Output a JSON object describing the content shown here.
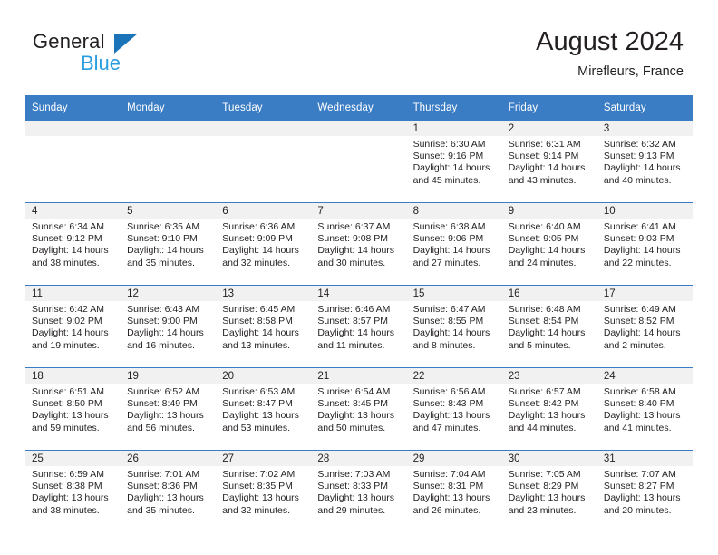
{
  "brand": {
    "name_part1": "General",
    "name_part2": "Blue",
    "logo_icon": "triangle-logo-icon"
  },
  "header": {
    "title": "August 2024",
    "location": "Mirefleurs, France"
  },
  "calendar": {
    "weekday_headers": [
      "Sunday",
      "Monday",
      "Tuesday",
      "Wednesday",
      "Thursday",
      "Friday",
      "Saturday"
    ],
    "colors": {
      "header_background": "#3b7dc4",
      "header_text": "#ffffff",
      "daynum_band": "#f1f1f1",
      "cell_background": "#ffffff",
      "text": "#231f20",
      "brand_blue": "#2a9ce0",
      "logo_blue": "#1b73b8"
    },
    "weeks": [
      [
        {
          "day": "",
          "empty": true,
          "sunrise": "",
          "sunset": "",
          "daylight_line1": "",
          "daylight_line2": ""
        },
        {
          "day": "",
          "empty": true,
          "sunrise": "",
          "sunset": "",
          "daylight_line1": "",
          "daylight_line2": ""
        },
        {
          "day": "",
          "empty": true,
          "sunrise": "",
          "sunset": "",
          "daylight_line1": "",
          "daylight_line2": ""
        },
        {
          "day": "",
          "empty": true,
          "sunrise": "",
          "sunset": "",
          "daylight_line1": "",
          "daylight_line2": ""
        },
        {
          "day": "1",
          "empty": false,
          "sunrise": "Sunrise: 6:30 AM",
          "sunset": "Sunset: 9:16 PM",
          "daylight_line1": "Daylight: 14 hours",
          "daylight_line2": "and 45 minutes."
        },
        {
          "day": "2",
          "empty": false,
          "sunrise": "Sunrise: 6:31 AM",
          "sunset": "Sunset: 9:14 PM",
          "daylight_line1": "Daylight: 14 hours",
          "daylight_line2": "and 43 minutes."
        },
        {
          "day": "3",
          "empty": false,
          "sunrise": "Sunrise: 6:32 AM",
          "sunset": "Sunset: 9:13 PM",
          "daylight_line1": "Daylight: 14 hours",
          "daylight_line2": "and 40 minutes."
        }
      ],
      [
        {
          "day": "4",
          "empty": false,
          "sunrise": "Sunrise: 6:34 AM",
          "sunset": "Sunset: 9:12 PM",
          "daylight_line1": "Daylight: 14 hours",
          "daylight_line2": "and 38 minutes."
        },
        {
          "day": "5",
          "empty": false,
          "sunrise": "Sunrise: 6:35 AM",
          "sunset": "Sunset: 9:10 PM",
          "daylight_line1": "Daylight: 14 hours",
          "daylight_line2": "and 35 minutes."
        },
        {
          "day": "6",
          "empty": false,
          "sunrise": "Sunrise: 6:36 AM",
          "sunset": "Sunset: 9:09 PM",
          "daylight_line1": "Daylight: 14 hours",
          "daylight_line2": "and 32 minutes."
        },
        {
          "day": "7",
          "empty": false,
          "sunrise": "Sunrise: 6:37 AM",
          "sunset": "Sunset: 9:08 PM",
          "daylight_line1": "Daylight: 14 hours",
          "daylight_line2": "and 30 minutes."
        },
        {
          "day": "8",
          "empty": false,
          "sunrise": "Sunrise: 6:38 AM",
          "sunset": "Sunset: 9:06 PM",
          "daylight_line1": "Daylight: 14 hours",
          "daylight_line2": "and 27 minutes."
        },
        {
          "day": "9",
          "empty": false,
          "sunrise": "Sunrise: 6:40 AM",
          "sunset": "Sunset: 9:05 PM",
          "daylight_line1": "Daylight: 14 hours",
          "daylight_line2": "and 24 minutes."
        },
        {
          "day": "10",
          "empty": false,
          "sunrise": "Sunrise: 6:41 AM",
          "sunset": "Sunset: 9:03 PM",
          "daylight_line1": "Daylight: 14 hours",
          "daylight_line2": "and 22 minutes."
        }
      ],
      [
        {
          "day": "11",
          "empty": false,
          "sunrise": "Sunrise: 6:42 AM",
          "sunset": "Sunset: 9:02 PM",
          "daylight_line1": "Daylight: 14 hours",
          "daylight_line2": "and 19 minutes."
        },
        {
          "day": "12",
          "empty": false,
          "sunrise": "Sunrise: 6:43 AM",
          "sunset": "Sunset: 9:00 PM",
          "daylight_line1": "Daylight: 14 hours",
          "daylight_line2": "and 16 minutes."
        },
        {
          "day": "13",
          "empty": false,
          "sunrise": "Sunrise: 6:45 AM",
          "sunset": "Sunset: 8:58 PM",
          "daylight_line1": "Daylight: 14 hours",
          "daylight_line2": "and 13 minutes."
        },
        {
          "day": "14",
          "empty": false,
          "sunrise": "Sunrise: 6:46 AM",
          "sunset": "Sunset: 8:57 PM",
          "daylight_line1": "Daylight: 14 hours",
          "daylight_line2": "and 11 minutes."
        },
        {
          "day": "15",
          "empty": false,
          "sunrise": "Sunrise: 6:47 AM",
          "sunset": "Sunset: 8:55 PM",
          "daylight_line1": "Daylight: 14 hours",
          "daylight_line2": "and 8 minutes."
        },
        {
          "day": "16",
          "empty": false,
          "sunrise": "Sunrise: 6:48 AM",
          "sunset": "Sunset: 8:54 PM",
          "daylight_line1": "Daylight: 14 hours",
          "daylight_line2": "and 5 minutes."
        },
        {
          "day": "17",
          "empty": false,
          "sunrise": "Sunrise: 6:49 AM",
          "sunset": "Sunset: 8:52 PM",
          "daylight_line1": "Daylight: 14 hours",
          "daylight_line2": "and 2 minutes."
        }
      ],
      [
        {
          "day": "18",
          "empty": false,
          "sunrise": "Sunrise: 6:51 AM",
          "sunset": "Sunset: 8:50 PM",
          "daylight_line1": "Daylight: 13 hours",
          "daylight_line2": "and 59 minutes."
        },
        {
          "day": "19",
          "empty": false,
          "sunrise": "Sunrise: 6:52 AM",
          "sunset": "Sunset: 8:49 PM",
          "daylight_line1": "Daylight: 13 hours",
          "daylight_line2": "and 56 minutes."
        },
        {
          "day": "20",
          "empty": false,
          "sunrise": "Sunrise: 6:53 AM",
          "sunset": "Sunset: 8:47 PM",
          "daylight_line1": "Daylight: 13 hours",
          "daylight_line2": "and 53 minutes."
        },
        {
          "day": "21",
          "empty": false,
          "sunrise": "Sunrise: 6:54 AM",
          "sunset": "Sunset: 8:45 PM",
          "daylight_line1": "Daylight: 13 hours",
          "daylight_line2": "and 50 minutes."
        },
        {
          "day": "22",
          "empty": false,
          "sunrise": "Sunrise: 6:56 AM",
          "sunset": "Sunset: 8:43 PM",
          "daylight_line1": "Daylight: 13 hours",
          "daylight_line2": "and 47 minutes."
        },
        {
          "day": "23",
          "empty": false,
          "sunrise": "Sunrise: 6:57 AM",
          "sunset": "Sunset: 8:42 PM",
          "daylight_line1": "Daylight: 13 hours",
          "daylight_line2": "and 44 minutes."
        },
        {
          "day": "24",
          "empty": false,
          "sunrise": "Sunrise: 6:58 AM",
          "sunset": "Sunset: 8:40 PM",
          "daylight_line1": "Daylight: 13 hours",
          "daylight_line2": "and 41 minutes."
        }
      ],
      [
        {
          "day": "25",
          "empty": false,
          "sunrise": "Sunrise: 6:59 AM",
          "sunset": "Sunset: 8:38 PM",
          "daylight_line1": "Daylight: 13 hours",
          "daylight_line2": "and 38 minutes."
        },
        {
          "day": "26",
          "empty": false,
          "sunrise": "Sunrise: 7:01 AM",
          "sunset": "Sunset: 8:36 PM",
          "daylight_line1": "Daylight: 13 hours",
          "daylight_line2": "and 35 minutes."
        },
        {
          "day": "27",
          "empty": false,
          "sunrise": "Sunrise: 7:02 AM",
          "sunset": "Sunset: 8:35 PM",
          "daylight_line1": "Daylight: 13 hours",
          "daylight_line2": "and 32 minutes."
        },
        {
          "day": "28",
          "empty": false,
          "sunrise": "Sunrise: 7:03 AM",
          "sunset": "Sunset: 8:33 PM",
          "daylight_line1": "Daylight: 13 hours",
          "daylight_line2": "and 29 minutes."
        },
        {
          "day": "29",
          "empty": false,
          "sunrise": "Sunrise: 7:04 AM",
          "sunset": "Sunset: 8:31 PM",
          "daylight_line1": "Daylight: 13 hours",
          "daylight_line2": "and 26 minutes."
        },
        {
          "day": "30",
          "empty": false,
          "sunrise": "Sunrise: 7:05 AM",
          "sunset": "Sunset: 8:29 PM",
          "daylight_line1": "Daylight: 13 hours",
          "daylight_line2": "and 23 minutes."
        },
        {
          "day": "31",
          "empty": false,
          "sunrise": "Sunrise: 7:07 AM",
          "sunset": "Sunset: 8:27 PM",
          "daylight_line1": "Daylight: 13 hours",
          "daylight_line2": "and 20 minutes."
        }
      ]
    ]
  }
}
